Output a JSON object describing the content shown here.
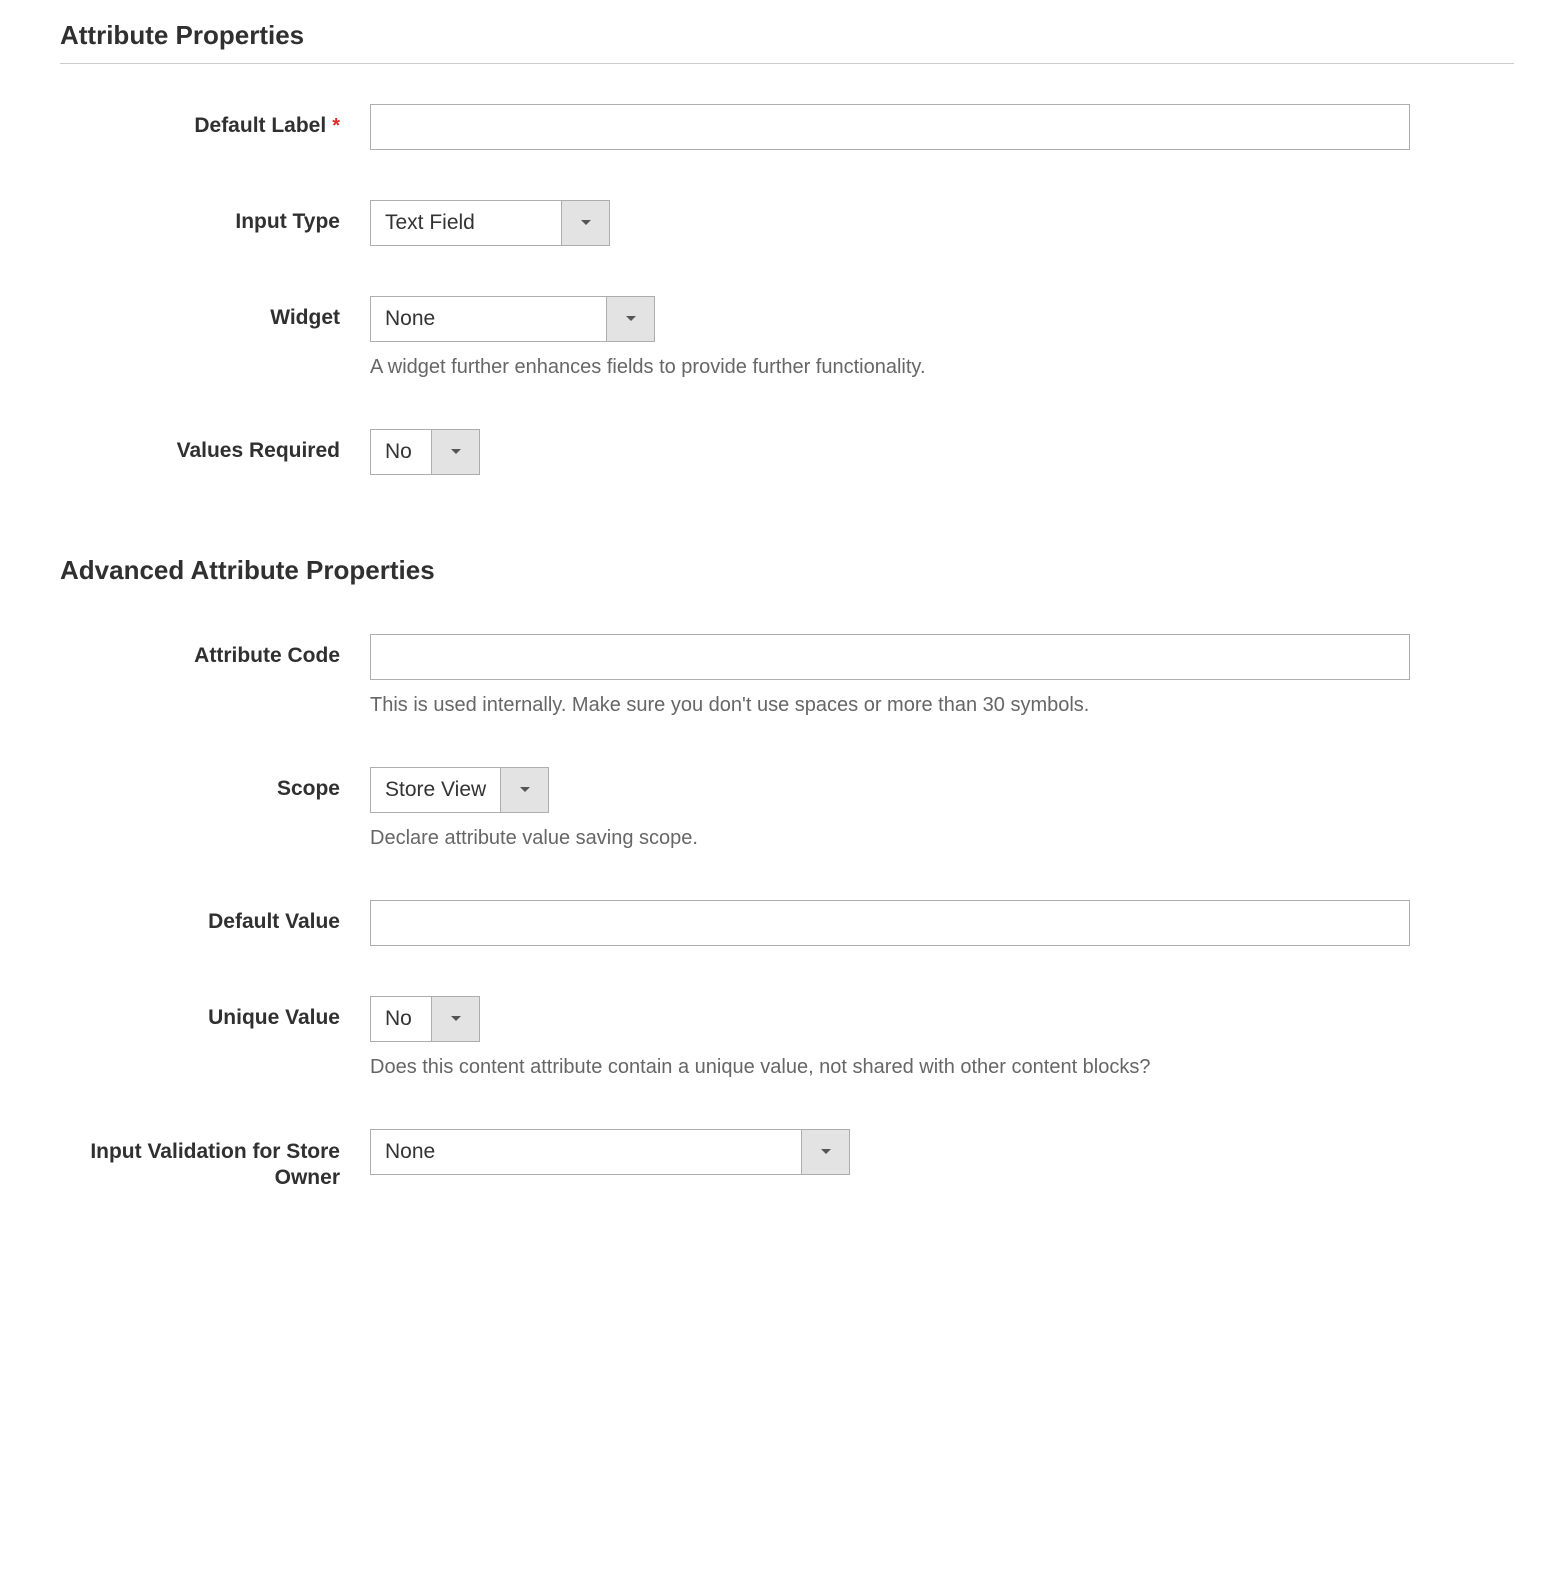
{
  "section1": {
    "title": "Attribute Properties",
    "default_label": {
      "label": "Default Label",
      "required_mark": "*",
      "value": ""
    },
    "input_type": {
      "label": "Input Type",
      "value": "Text Field"
    },
    "widget": {
      "label": "Widget",
      "value": "None",
      "help": "A widget further enhances fields to provide further functionality."
    },
    "values_required": {
      "label": "Values Required",
      "value": "No"
    }
  },
  "section2": {
    "title": "Advanced Attribute Properties",
    "attribute_code": {
      "label": "Attribute Code",
      "value": "",
      "help": "This is used internally. Make sure you don't use spaces or more than 30 symbols."
    },
    "scope": {
      "label": "Scope",
      "value": "Store View",
      "help": "Declare attribute value saving scope."
    },
    "default_value": {
      "label": "Default Value",
      "value": ""
    },
    "unique_value": {
      "label": "Unique Value",
      "value": "No",
      "help": "Does this content attribute contain a unique value, not shared with other content blocks?"
    },
    "input_validation": {
      "label": "Input Validation for Store Owner",
      "value": "None"
    }
  }
}
